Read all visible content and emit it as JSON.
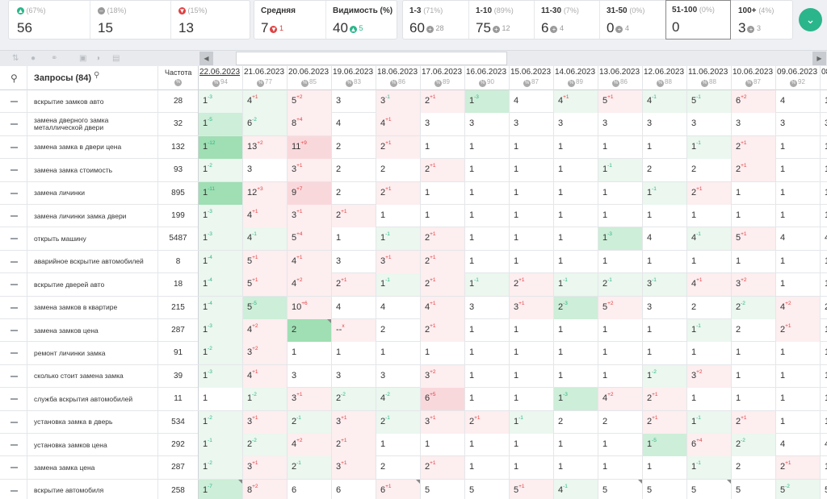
{
  "summary": {
    "groups": [
      {
        "icon": "up-circle-icon",
        "color": "#2bb58a",
        "pct": "(67%)",
        "value": "56"
      },
      {
        "icon": "minus-circle-icon",
        "color": "#999999",
        "pct": "(18%)",
        "value": "15"
      },
      {
        "icon": "down-circle-icon",
        "color": "#e04141",
        "pct": "(15%)",
        "value": "13"
      }
    ],
    "avg": {
      "label": "Средняя",
      "value": "7",
      "delta": "1",
      "dir": "down"
    },
    "visibility": {
      "label": "Видимость (%)",
      "value": "40",
      "delta": "5",
      "dir": "up"
    },
    "ranges": [
      {
        "label": "1-3",
        "pct": "(71%)",
        "value": "60",
        "delta": "28",
        "dir": "neutral"
      },
      {
        "label": "1-10",
        "pct": "(89%)",
        "value": "75",
        "delta": "12",
        "dir": "neutral"
      },
      {
        "label": "11-30",
        "pct": "(7%)",
        "value": "6",
        "delta": "4",
        "dir": "neutral"
      },
      {
        "label": "31-50",
        "pct": "(0%)",
        "value": "0",
        "delta": "4",
        "dir": "neutral"
      },
      {
        "label": "51-100",
        "pct": "(0%)",
        "value": "0",
        "delta": "",
        "dir": "none"
      },
      {
        "label": "100+",
        "pct": "(4%)",
        "value": "3",
        "delta": "3",
        "dir": "neutral"
      }
    ]
  },
  "header": {
    "queries_label": "Запросы (84)",
    "freq_label": "Частота",
    "dates": [
      {
        "date": "22.06.2023",
        "vis": "94",
        "link": true
      },
      {
        "date": "21.06.2023",
        "vis": "77"
      },
      {
        "date": "20.06.2023",
        "vis": "85"
      },
      {
        "date": "19.06.2023",
        "vis": "83"
      },
      {
        "date": "18.06.2023",
        "vis": "86"
      },
      {
        "date": "17.06.2023",
        "vis": "89"
      },
      {
        "date": "16.06.2023",
        "vis": "90"
      },
      {
        "date": "15.06.2023",
        "vis": "87"
      },
      {
        "date": "14.06.2023",
        "vis": "89"
      },
      {
        "date": "13.06.2023",
        "vis": "86"
      },
      {
        "date": "12.06.2023",
        "vis": "88"
      },
      {
        "date": "11.06.2023",
        "vis": "88"
      },
      {
        "date": "10.06.2023",
        "vis": "87"
      },
      {
        "date": "09.06.2023",
        "vis": "92"
      },
      {
        "date": "08",
        "vis": ""
      }
    ]
  },
  "rows": [
    {
      "q": "вскрытие замков авто",
      "f": "28",
      "c": [
        "1|-3|g",
        "4|+1|g",
        "5|+2|r",
        "3||",
        "3|-1|r",
        "2|+1|r",
        "1|-3|g2",
        "4||",
        "4|+1|g",
        "5|+1|r",
        "4|-1|g",
        "5|-1|g",
        "6|+2|r",
        "4||",
        "1||"
      ]
    },
    {
      "q": "замена дверного замка металлической двери",
      "f": "32",
      "c": [
        "1|-5|g2",
        "6|-2|g",
        "8|+4|r",
        "4||",
        "4|+1|r",
        "3||",
        "3||",
        "3||",
        "3||",
        "3||",
        "3||",
        "3||",
        "3||",
        "3||",
        "3||"
      ]
    },
    {
      "q": "замена замка в двери цена",
      "f": "132",
      "c": [
        "1|-12|g3",
        "13|+2|r",
        "11|+9|r2",
        "2||",
        "2|+1|r",
        "1||",
        "1||",
        "1||",
        "1||",
        "1||",
        "1||",
        "1|-1|g",
        "2|+1|r",
        "1||",
        "1||"
      ]
    },
    {
      "q": "замена замка стоимость",
      "f": "93",
      "c": [
        "1|-2|g",
        "3||",
        "3|+1|r",
        "2||",
        "2||",
        "2|+1|r",
        "1||",
        "1||",
        "1||",
        "1|-1|g",
        "2||",
        "2||",
        "2|+1|r",
        "1||",
        "1||"
      ]
    },
    {
      "q": "замена личинки",
      "f": "895",
      "c": [
        "1|-11|g3",
        "12|+3|r",
        "9|+7|r2",
        "2||",
        "2|+1|r",
        "1||",
        "1||",
        "1||",
        "1||",
        "1||",
        "1|-1|g",
        "2|+1|r",
        "1||",
        "1||",
        "1||"
      ]
    },
    {
      "q": "замена личинки замка двери",
      "f": "199",
      "c": [
        "1|-3|g",
        "4|+1|r",
        "3|+1|r",
        "2|+1|r",
        "1||",
        "1||",
        "1||",
        "1||",
        "1||",
        "1||",
        "1||",
        "1||",
        "1||",
        "1||",
        "1||"
      ]
    },
    {
      "q": "открыть машину",
      "f": "5487",
      "c": [
        "1|-3|g",
        "4|-1|g",
        "5|+4|r",
        "1||",
        "1|-1|g",
        "2|+1|r",
        "1||",
        "1||",
        "1||",
        "1|-3|g2",
        "4||",
        "4|-1|g",
        "5|+1|r",
        "4||",
        "4||"
      ]
    },
    {
      "q": "аварийное вскрытие автомобилей",
      "f": "8",
      "c": [
        "1|-4|g",
        "5|+1|r",
        "4|+1|r",
        "3||",
        "3|+1|r",
        "2|+1|r",
        "1||",
        "1||",
        "1||",
        "1||",
        "1||",
        "1||",
        "1||",
        "1||",
        "1||"
      ]
    },
    {
      "q": "вскрытие дверей авто",
      "f": "18",
      "c": [
        "1|-4|g",
        "5|+1|r",
        "4|+2|r",
        "2|+1|r",
        "1|-1|g",
        "2|+1|r",
        "1|-1|g",
        "2|+1|r",
        "1|-1|g",
        "2|-1|g",
        "3|-1|g",
        "4|+1|r",
        "3|+2|r",
        "1||",
        "1||"
      ]
    },
    {
      "q": "замена замков в квартире",
      "f": "215",
      "c": [
        "1|-4|g",
        "5|-5|g2",
        "10|+6|r",
        "4||",
        "4||",
        "4|+1|r",
        "3||",
        "3|+1|r",
        "2|-3|g2",
        "5|+2|r",
        "3||",
        "2||",
        "2|-2|g",
        "4|+2|r",
        "2||"
      ]
    },
    {
      "q": "замена замков цена",
      "f": "287",
      "c": [
        "1|-3|g",
        "4|+2|r",
        "2||g3",
        "--|x|r",
        "2||",
        "2|+1|r",
        "1||",
        "1||",
        "1||",
        "1||",
        "1||",
        "1|-1|g",
        "2||",
        "2|+1|r",
        "1||"
      ]
    },
    {
      "q": "ремонт личинки замка",
      "f": "91",
      "c": [
        "1|-2|g",
        "3|+2|r",
        "1||",
        "1||",
        "1||",
        "1||",
        "1||",
        "1||",
        "1||",
        "1||",
        "1||",
        "1||",
        "1||",
        "1||",
        "1||"
      ]
    },
    {
      "q": "сколько стоит замена замка",
      "f": "39",
      "c": [
        "1|-3|g",
        "4|+1|r",
        "3||",
        "3||",
        "3||",
        "3|+2|r",
        "1||",
        "1||",
        "1||",
        "1||",
        "1|-2|g",
        "3|+2|r",
        "1||",
        "1||",
        "1||"
      ]
    },
    {
      "q": "служба вскрытия автомобилей",
      "f": "11",
      "c": [
        "1||",
        "1|-2|g",
        "3|+1|r",
        "2|-2|g",
        "4|-2|g",
        "6|+5|r2",
        "1||",
        "1||",
        "1|-3|g2",
        "4|+2|r",
        "2|+1|r",
        "1||",
        "1||",
        "1||",
        "1||"
      ]
    },
    {
      "q": "установка замка в дверь",
      "f": "534",
      "c": [
        "1|-2|g",
        "3|+1|r",
        "2|-1|g",
        "3|+1|r",
        "2|-1|g",
        "3|+1|r",
        "2|+1|r",
        "1|-1|g",
        "2||",
        "2||",
        "2|+1|r",
        "1|-1|g",
        "2|+1|r",
        "1||",
        "1||"
      ]
    },
    {
      "q": "установка замков цена",
      "f": "292",
      "c": [
        "1|-1|g",
        "2|-2|g",
        "4|+2|r",
        "2|+1|r",
        "1||",
        "1||",
        "1||",
        "1||",
        "1||",
        "1||",
        "1|-5|g2",
        "6|+4|r",
        "2|-2|g",
        "4||",
        "4||"
      ]
    },
    {
      "q": "замена замка цена",
      "f": "287",
      "c": [
        "1|-2|g",
        "3|+1|r",
        "2|-1|g",
        "3|+1|r",
        "2||",
        "2|+1|r",
        "1||",
        "1||",
        "1||",
        "1||",
        "1||",
        "1|-1|g",
        "2||",
        "2|+1|r",
        "1||"
      ]
    },
    {
      "q": "вскрытие автомобиля",
      "f": "258",
      "c": [
        "1|-7|g2",
        "8|+2|r",
        "6||",
        "6||",
        "6|+1|r",
        "5||",
        "5||",
        "5|+1|r",
        "4|-1|g",
        "5||",
        "5||",
        "5||",
        "5||",
        "5|-2|g",
        "5||"
      ]
    }
  ]
}
